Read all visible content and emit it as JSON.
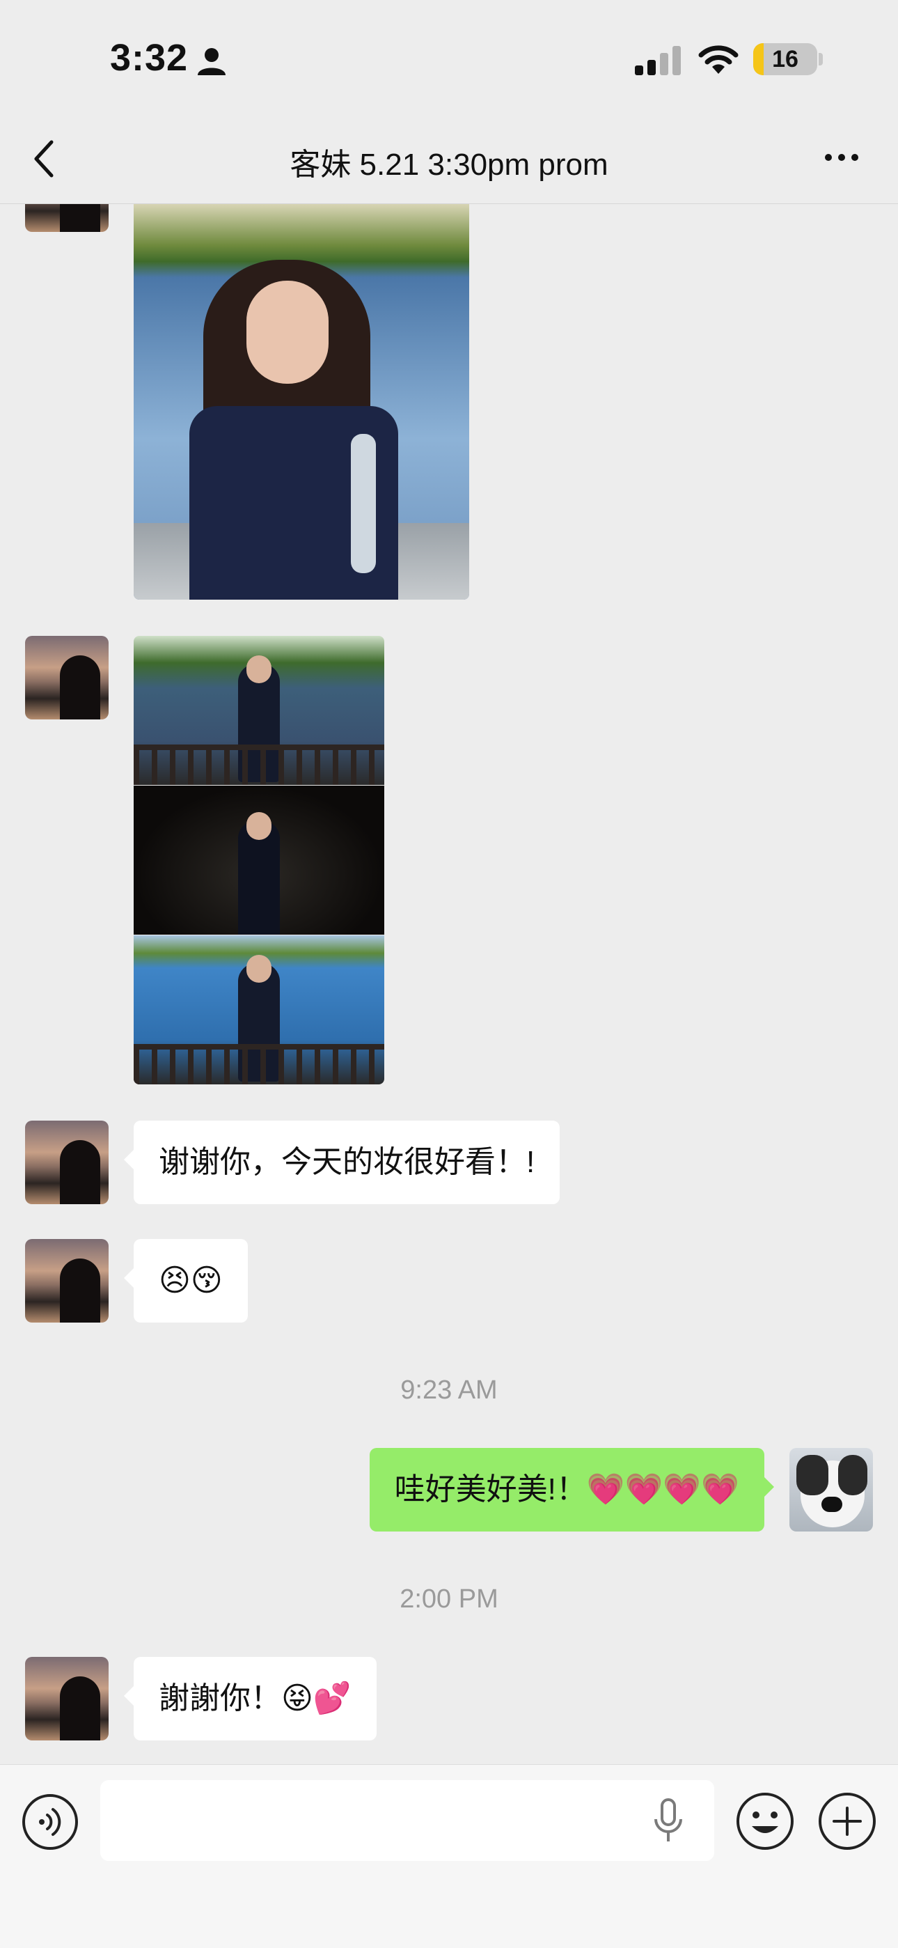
{
  "status_bar": {
    "time": "3:32",
    "battery": "16",
    "battery_level": 0.16,
    "icons": [
      "person-icon",
      "signal-icon",
      "wifi-icon",
      "battery-charging-icon"
    ]
  },
  "nav": {
    "title": "客妹 5.21 3:30pm prom",
    "back_icon": "chevron-left-icon",
    "more_icon": "ellipsis-icon"
  },
  "messages": [
    {
      "type": "image",
      "sender": "them"
    },
    {
      "type": "image-grid",
      "sender": "them",
      "images": 3
    },
    {
      "type": "text",
      "sender": "them",
      "text": "谢谢你，今天的妆很好看！!"
    },
    {
      "type": "text",
      "sender": "them",
      "text": "😣😚"
    },
    {
      "type": "time",
      "text": "9:23 AM"
    },
    {
      "type": "text",
      "sender": "me",
      "text": "哇好美好美!！💗💗💗💗"
    },
    {
      "type": "time",
      "text": "2:00 PM"
    },
    {
      "type": "text",
      "sender": "them",
      "text": "謝謝你！😝💕"
    }
  ],
  "input_bar": {
    "placeholder": "",
    "icons": [
      "voice-icon",
      "microphone-icon",
      "emoji-icon",
      "plus-icon"
    ]
  },
  "colors": {
    "background": "#ededed",
    "my_bubble": "#95ec69",
    "their_bubble": "#ffffff",
    "battery_fill": "#f5c518"
  }
}
